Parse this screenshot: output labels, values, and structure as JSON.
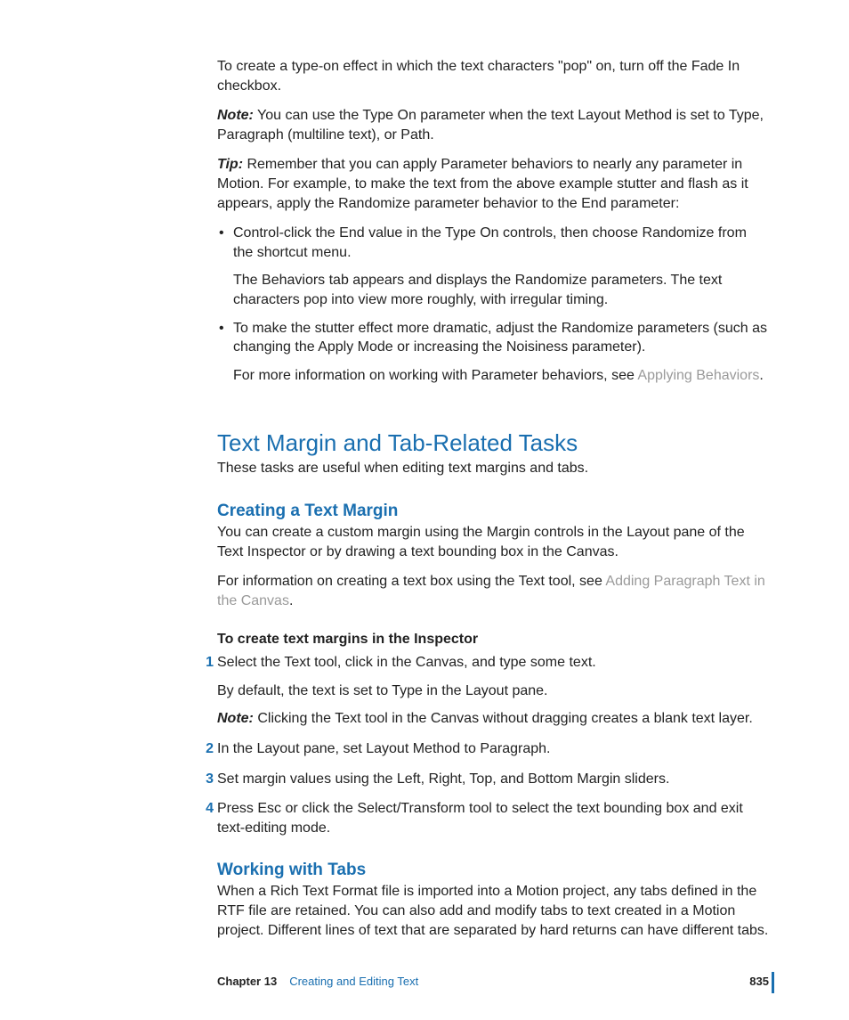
{
  "intro": {
    "p1": "To create a type-on effect in which the text characters \"pop\" on, turn off the Fade In checkbox.",
    "note_label": "Note:",
    "note_text": "  You can use the Type On parameter when the text Layout Method is set to Type, Paragraph (multiline text), or Path.",
    "tip_label": "Tip:",
    "tip_text": "  Remember that you can apply Parameter behaviors to nearly any parameter in Motion. For example, to make the text from the above example stutter and flash as it appears, apply the Randomize parameter behavior to the End parameter:",
    "bullet1_a": "Control-click the End value in the Type On controls, then choose Randomize from the shortcut menu.",
    "bullet1_b": "The Behaviors tab appears and displays the Randomize parameters. The text characters pop into view more roughly, with irregular timing.",
    "bullet2_a": "To make the stutter effect more dramatic, adjust the Randomize parameters (such as changing the Apply Mode or increasing the Noisiness parameter).",
    "bullet2_b_pre": "For more information on working with Parameter behaviors, see ",
    "bullet2_b_link": "Applying Behaviors",
    "bullet2_b_post": "."
  },
  "section": {
    "title": "Text Margin and Tab-Related Tasks",
    "intro": "These tasks are useful when editing text margins and tabs."
  },
  "margin": {
    "title": "Creating a Text Margin",
    "p1": "You can create a custom margin using the Margin controls in the Layout pane of the Text Inspector or by drawing a text bounding box in the Canvas.",
    "p2_pre": "For information on creating a text box using the Text tool, see ",
    "p2_link": "Adding Paragraph Text in the Canvas",
    "p2_post": ".",
    "steps_heading": "To create text margins in the Inspector",
    "step1_num": "1",
    "step1": "Select the Text tool, click in the Canvas, and type some text.",
    "step1_sub": "By default, the text is set to Type in the Layout pane.",
    "step1_note_label": "Note:",
    "step1_note_text": "  Clicking the Text tool in the Canvas without dragging creates a blank text layer.",
    "step2_num": "2",
    "step2": "In the Layout pane, set Layout Method to Paragraph.",
    "step3_num": "3",
    "step3": "Set margin values using the Left, Right, Top, and Bottom Margin sliders.",
    "step4_num": "4",
    "step4": "Press Esc or click the Select/Transform tool to select the text bounding box and exit text-editing mode."
  },
  "tabs": {
    "title": "Working with Tabs",
    "p1": "When a Rich Text Format file is imported into a Motion project, any tabs defined in the RTF file are retained. You can also add and modify tabs to text created in a Motion project. Different lines of text that are separated by hard returns can have different tabs."
  },
  "footer": {
    "chapter": "Chapter 13",
    "title": "Creating and Editing Text",
    "page": "835"
  }
}
